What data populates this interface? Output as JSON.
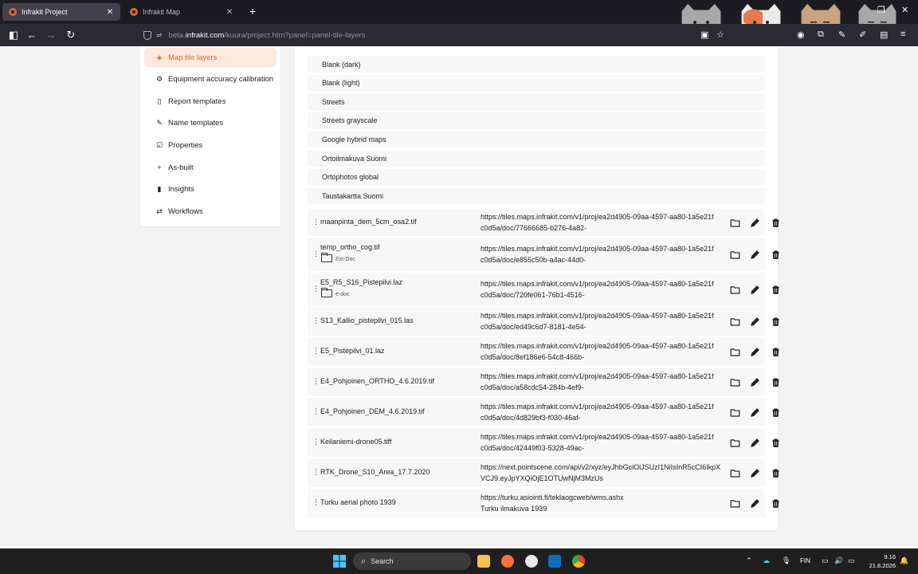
{
  "browser": {
    "tabs": [
      {
        "title": "Infrakit Project",
        "active": true
      },
      {
        "title": "Infrakit Map",
        "active": false
      }
    ],
    "url_prefix": "beta.",
    "url_domain": "infrakit.com",
    "url_path": "/kuura/project.htm?panel=panel-tile-layers",
    "accent": "#e0672b"
  },
  "sidebar": {
    "items": [
      {
        "label": "Map tile layers",
        "icon": "layers-icon",
        "active": true
      },
      {
        "label": "Equipment accuracy calibration",
        "icon": "calibration-icon"
      },
      {
        "label": "Report templates",
        "icon": "document-icon"
      },
      {
        "label": "Name templates",
        "icon": "pencil-icon"
      },
      {
        "label": "Properties",
        "icon": "properties-icon"
      },
      {
        "label": "As-built",
        "icon": "crosshair-icon"
      },
      {
        "label": "Insights",
        "icon": "chart-icon"
      },
      {
        "label": "Workflows",
        "icon": "workflow-icon"
      }
    ]
  },
  "base_layers": [
    "Blank (dark)",
    "Blank (light)",
    "Streets",
    "Streets grayscale",
    "Google hybrid maps",
    "Ortoilmakuva Suomi",
    "Ortophotos global",
    "Taustakartta Suomi"
  ],
  "layers": [
    {
      "name": "maanpinta_dem_5cm_osa2.tif",
      "url1": "https://tiles.maps.infrakit.com/v1/proj/ea2d4905-09aa-4597-aa80-1a5e21f",
      "url2": "c0d5a/doc/77666685-b276-4a82-"
    },
    {
      "name": "temp_ortho_cog.tif",
      "sub": "Ext-Doc",
      "url1": "https://tiles.maps.infrakit.com/v1/proj/ea2d4905-09aa-4597-aa80-1a5e21f",
      "url2": "c0d5a/doc/e855c50b-a4ac-44d0-"
    },
    {
      "name": "E5_R5_S16_Pistepilvi.laz",
      "sub": "e-doc",
      "url1": "https://tiles.maps.infrakit.com/v1/proj/ea2d4905-09aa-4597-aa80-1a5e21f",
      "url2": "c0d5a/doc/720fe061-76b1-4516-"
    },
    {
      "name": "S13_Kallio_pistepilvi_015.las",
      "url1": "https://tiles.maps.infrakit.com/v1/proj/ea2d4905-09aa-4597-aa80-1a5e21f",
      "url2": "c0d5a/doc/ed49c6d7-8181-4e54-"
    },
    {
      "name": "E5_Pistepilvi_01.laz",
      "url1": "https://tiles.maps.infrakit.com/v1/proj/ea2d4905-09aa-4597-aa80-1a5e21f",
      "url2": "c0d5a/doc/8ef186e6-54c8-466b-"
    },
    {
      "name": "E4_Pohjoinen_ORTHO_4.6.2019.tif",
      "url1": "https://tiles.maps.infrakit.com/v1/proj/ea2d4905-09aa-4597-aa80-1a5e21f",
      "url2": "c0d5a/doc/a58cdc54-284b-4ef9-"
    },
    {
      "name": "E4_Pohjoinen_DEM_4.6.2019.tif",
      "url1": "https://tiles.maps.infrakit.com/v1/proj/ea2d4905-09aa-4597-aa80-1a5e21f",
      "url2": "c0d5a/doc/4d829bf3-f030-46af-"
    },
    {
      "name": "Keilaniemi-drone05.tiff",
      "url1": "https://tiles.maps.infrakit.com/v1/proj/ea2d4905-09aa-4597-aa80-1a5e21f",
      "url2": "c0d5a/doc/42449f03-5328-49ac-"
    },
    {
      "name": "RTK_Drone_S10_Area_17.7.2020",
      "url1": "https://next.pointscene.com/api/v2/xyz/eyJhbGciOiJSUzI1NiIsInR5cCI6IkpX",
      "url2": "VCJ9.eyJpYXQiOjE1OTUwNjM3MzUs"
    },
    {
      "name": "Turku aerial photo 1939",
      "url1": "https://turku.asiointi.fi/teklaogcweb/wms.ashx",
      "url2": "Turku ilmakuva 1939"
    }
  ],
  "taskbar": {
    "search_label": "Search",
    "lang": "FIN",
    "time": "9.16",
    "date": "21.8.2026"
  }
}
